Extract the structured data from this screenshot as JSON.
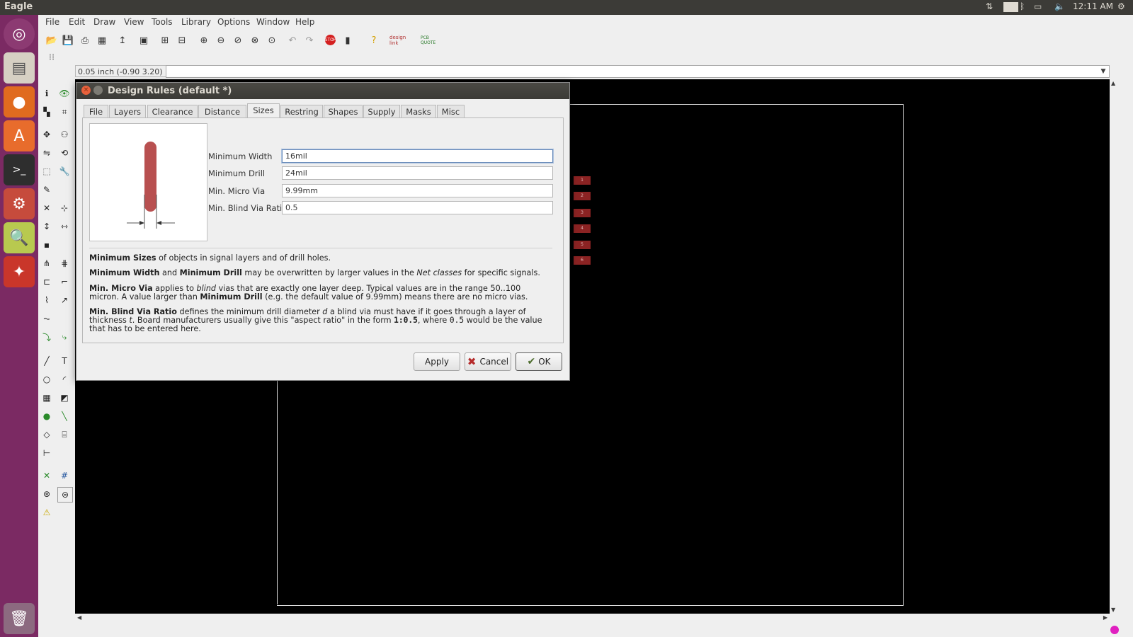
{
  "topbar": {
    "app_name": "Eagle",
    "keyboard_layout": "En",
    "clock": "12:11 AM"
  },
  "menubar": {
    "items": [
      "File",
      "Edit",
      "Draw",
      "View",
      "Tools",
      "Library",
      "Options",
      "Window",
      "Help"
    ]
  },
  "toolbar": {
    "icons": [
      "open-icon",
      "save-icon",
      "print-icon",
      "cam-icon",
      "script-icon",
      "ulp-icon",
      "fit-icon",
      "zoom-select-icon",
      "zoom-in-icon",
      "zoom-out-icon",
      "zoom-prev-icon",
      "zoom-area-icon",
      "undo-icon",
      "redo-icon",
      "stop-icon",
      "go-icon",
      "help-icon",
      "design-link-icon",
      "pcb-quote-icon"
    ],
    "design_link_label": "design link",
    "pcb_quote_label": "PCB QUOTE"
  },
  "coord_display": "0.05 inch (-0.90 3.20)",
  "dialog": {
    "title": "Design Rules (default *)",
    "tabs": [
      "File",
      "Layers",
      "Clearance",
      "Distance",
      "Sizes",
      "Restring",
      "Shapes",
      "Supply",
      "Masks",
      "Misc"
    ],
    "active_tab": "Sizes",
    "fields": [
      {
        "label": "Minimum Width",
        "value": "16mil"
      },
      {
        "label": "Minimum Drill",
        "value": "24mil"
      },
      {
        "label": "Min. Micro Via",
        "value": "9.99mm"
      },
      {
        "label": "Min. Blind Via Ratio",
        "value": "0.5"
      }
    ],
    "help": {
      "p1_b1": "Minimum Sizes",
      "p1_t1": " of objects in signal layers and of drill holes.",
      "p2_b1": "Minimum Width",
      "p2_t1": " and ",
      "p2_b2": "Minimum Drill",
      "p2_t2": " may be overwritten by larger values in the ",
      "p2_i1": "Net classes",
      "p2_t3": " for specific signals.",
      "p3_b1": "Min. Micro Via",
      "p3_t1": " applies to ",
      "p3_i1": "blind",
      "p3_t2": " vias that are exactly one layer deep. Typical values are in the range 50..100 micron. A value larger than ",
      "p3_b2": "Minimum Drill",
      "p3_t3": " (e.g. the default value of 9.99mm) means there are no micro vias.",
      "p4_b1": "Min. Blind Via Ratio",
      "p4_t1": " defines the minimum drill diameter ",
      "p4_i1": "d",
      "p4_t2": " a blind via must have if it goes through a layer of thickness ",
      "p4_i2": "t",
      "p4_t3": ". Board manufacturers usually give this \"aspect ratio\" in the form ",
      "p4_m1": "1:0.5",
      "p4_t4": ", where ",
      "p4_m2": "0.5",
      "p4_t5": " would be the value that has to be entered here."
    },
    "buttons": {
      "apply": "Apply",
      "cancel": "Cancel",
      "ok": "OK"
    }
  },
  "board_pads": [
    "1",
    "2",
    "3",
    "4",
    "5",
    "6"
  ],
  "colors": {
    "launcher": "#7b2a63",
    "canvas": "#000000",
    "pad": "#8b2323",
    "panel": "#3c3b37"
  }
}
